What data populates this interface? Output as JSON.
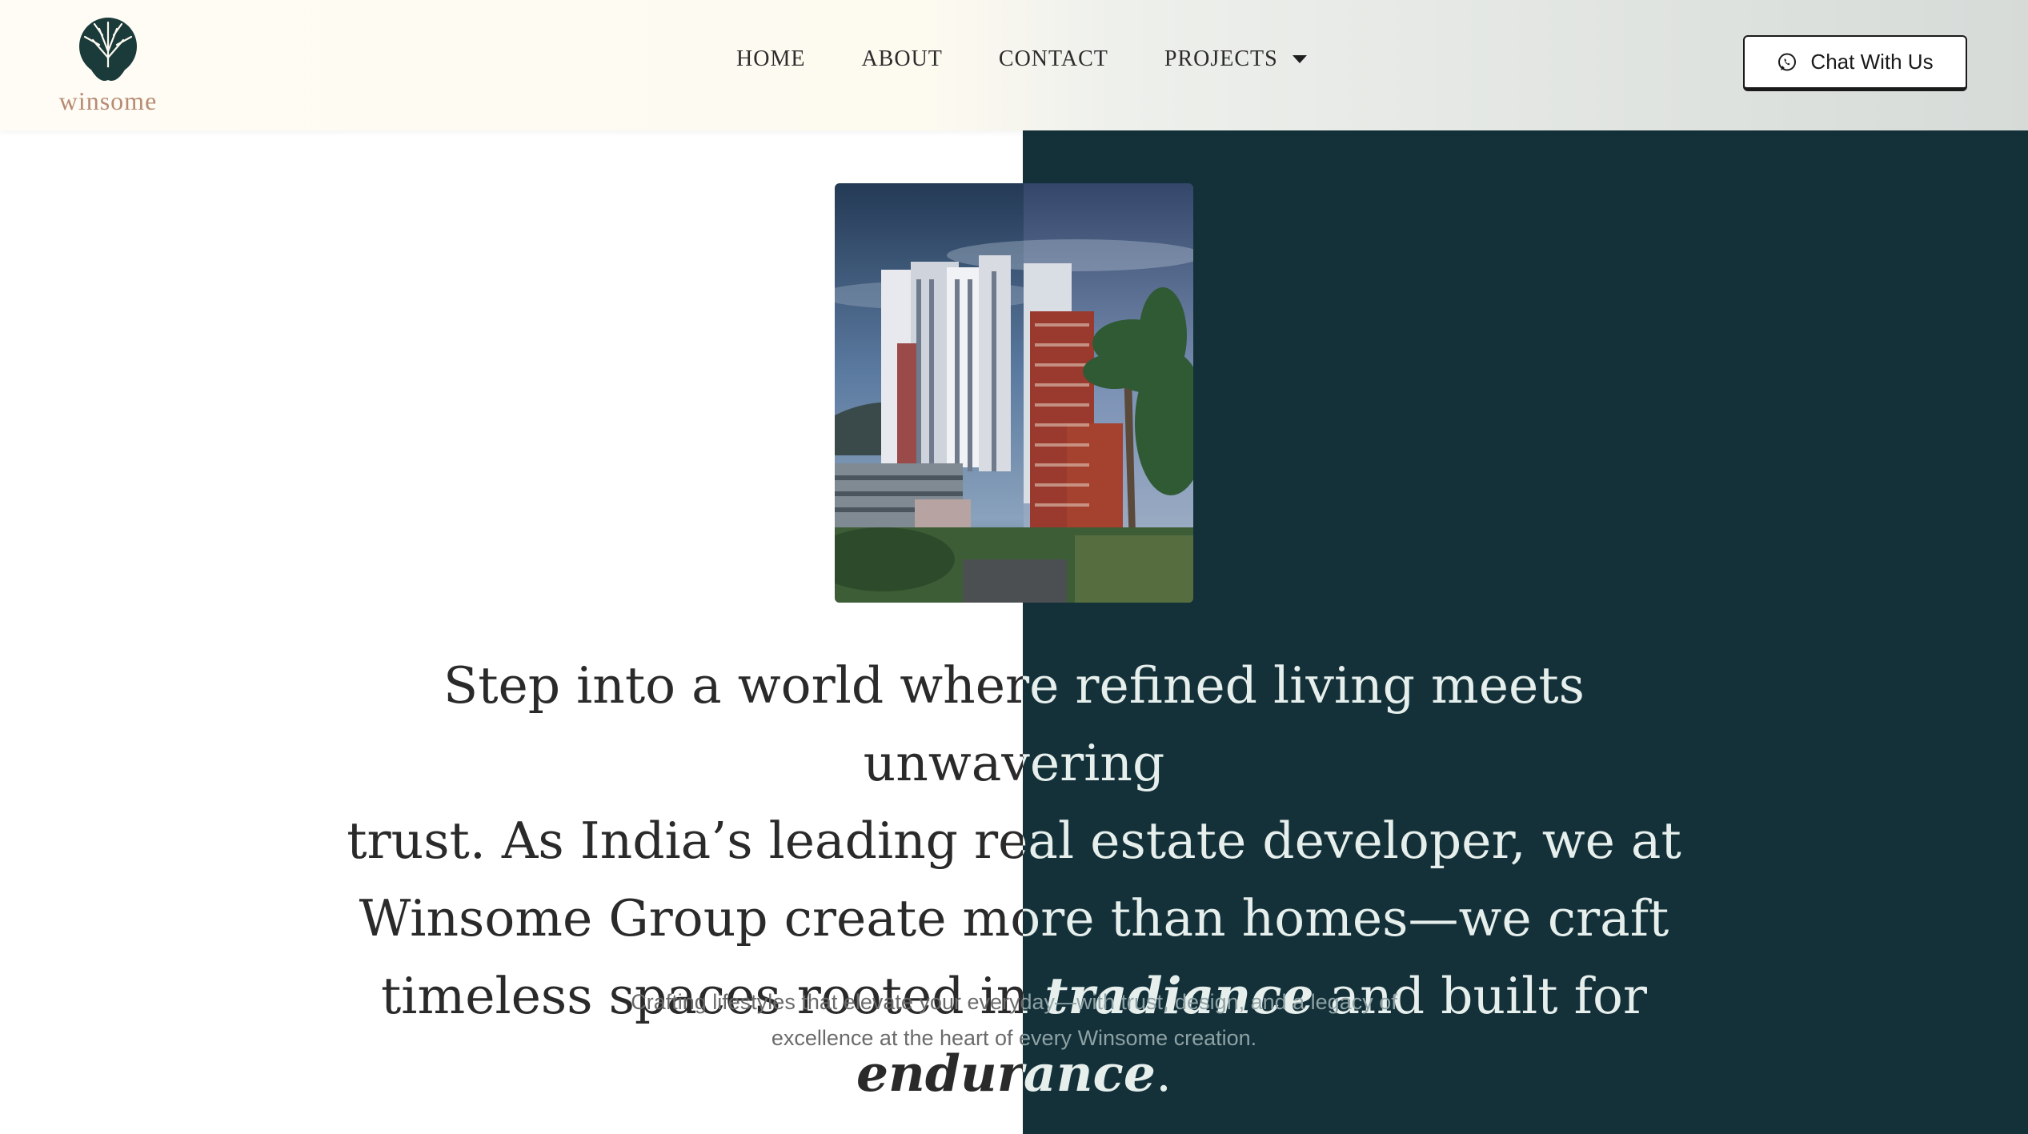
{
  "brand": {
    "name": "winsome",
    "logo_icon": "tree-icon"
  },
  "nav": {
    "items": [
      {
        "label": "HOME"
      },
      {
        "label": "ABOUT"
      },
      {
        "label": "CONTACT"
      },
      {
        "label": "PROJECTS"
      }
    ]
  },
  "header": {
    "chat_label": "Chat With Us",
    "chat_icon": "whatsapp-icon"
  },
  "hero": {
    "headline_lines": [
      "Step into a world where refined living meets unwavering",
      "trust. As India’s leading real estate developer, we at",
      "Winsome Group create more than homes—we craft"
    ],
    "headline_last_prefix": "timeless spaces rooted in ",
    "headline_em1": "tradiance",
    "headline_mid": " and built for ",
    "headline_em2": "endurance",
    "headline_end": ".",
    "subtext_line1": "Crafting lifestyles that elevate your everyday—with trust, design, and a legacy of",
    "subtext_line2": "excellence at the heart of every Winsome creation."
  },
  "colors": {
    "dark_panel": "#14313a",
    "logo_green": "#1b3a3a",
    "logo_text": "#b88a73"
  }
}
